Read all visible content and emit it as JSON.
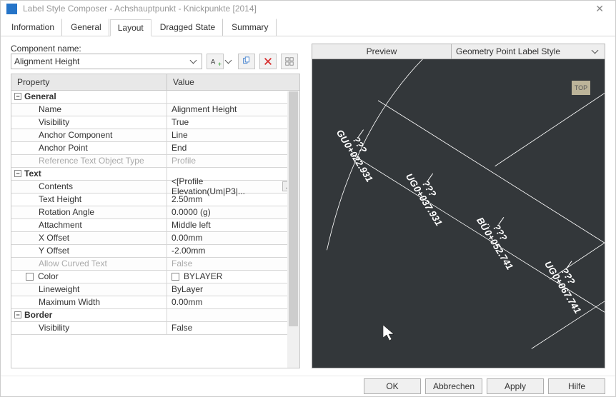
{
  "window": {
    "title": "Label Style Composer - Achshauptpunkt - Knickpunkte [2014]"
  },
  "tabs": [
    "Information",
    "General",
    "Layout",
    "Dragged State",
    "Summary"
  ],
  "active_tab": "Layout",
  "component_name_label": "Component name:",
  "component_name_value": "Alignment Height",
  "prop_header": {
    "left": "Property",
    "right": "Value"
  },
  "groups": {
    "general": {
      "label": "General",
      "rows": [
        {
          "name": "Name",
          "value": "Alignment Height"
        },
        {
          "name": "Visibility",
          "value": "True"
        },
        {
          "name": "Anchor Component",
          "value": "Line"
        },
        {
          "name": "Anchor Point",
          "value": "End"
        },
        {
          "name": "Reference Text Object Type",
          "value": "Profile",
          "muted": true
        }
      ]
    },
    "text": {
      "label": "Text",
      "rows": [
        {
          "name": "Contents",
          "value": "<[Profile Elevation(Um|P3|...",
          "ellipsis": true
        },
        {
          "name": "Text Height",
          "value": "2.50mm"
        },
        {
          "name": "Rotation Angle",
          "value": "0.0000 (g)"
        },
        {
          "name": "Attachment",
          "value": "Middle left"
        },
        {
          "name": "X Offset",
          "value": "0.00mm"
        },
        {
          "name": "Y Offset",
          "value": "-2.00mm"
        },
        {
          "name": "Allow Curved Text",
          "value": "False",
          "muted": true
        },
        {
          "name": "Color",
          "value": "BYLAYER",
          "checkbox": true,
          "name_checkbox": true
        },
        {
          "name": "Lineweight",
          "value": "ByLayer"
        },
        {
          "name": "Maximum Width",
          "value": "0.00mm"
        }
      ]
    },
    "border": {
      "label": "Border",
      "rows": [
        {
          "name": "Visibility",
          "value": "False"
        }
      ]
    }
  },
  "preview": {
    "tab": "Preview",
    "combo": "Geometry Point Label Style",
    "top_badge": "TOP",
    "labels": [
      {
        "tag": "GU",
        "station": "0+022.931"
      },
      {
        "tag": "UG",
        "station": "0+037.931"
      },
      {
        "tag": "BÜ",
        "station": "0+052.741"
      },
      {
        "tag": "UG",
        "station": "0+067.741"
      }
    ]
  },
  "footer": {
    "ok": "OK",
    "cancel": "Abbrechen",
    "apply": "Apply",
    "help": "Hilfe"
  }
}
